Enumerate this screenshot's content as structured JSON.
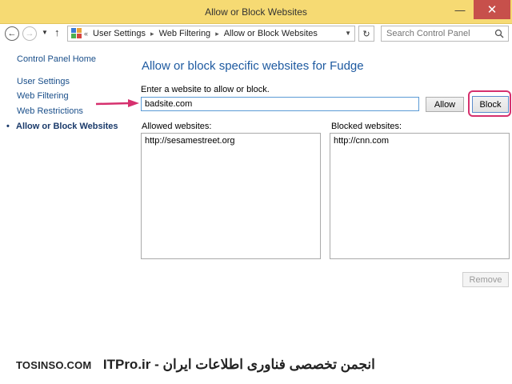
{
  "window": {
    "title": "Allow or Block Websites",
    "minimize_glyph": "—",
    "close_glyph": "✕",
    "close_color": "#c7504b",
    "titlebar_color": "#f6da73"
  },
  "nav": {
    "back_icon": "back-arrow-icon",
    "forward_icon": "forward-arrow-icon",
    "up_icon": "up-arrow-icon",
    "breadcrumb_prefix": "«",
    "breadcrumbs": [
      "User Settings",
      "Web Filtering",
      "Allow or Block Websites"
    ],
    "search_placeholder": "Search Control Panel"
  },
  "sidebar": {
    "home": "Control Panel Home",
    "links": [
      "User Settings",
      "Web Filtering",
      "Web Restrictions"
    ],
    "current": "Allow or Block Websites"
  },
  "main": {
    "heading": "Allow or block specific websites for Fudge",
    "prompt": "Enter a website to allow or block.",
    "input_value": "badsite.com",
    "allow_label": "Allow",
    "block_label": "Block",
    "allowed_label": "Allowed websites:",
    "blocked_label": "Blocked websites:",
    "allowed_sites": [
      "http://sesamestreet.org"
    ],
    "blocked_sites": [
      "http://cnn.com"
    ],
    "remove_label": "Remove"
  },
  "annotation": {
    "highlight_color": "#d6306e"
  },
  "watermark": {
    "site": "TOSINSO.COM",
    "text": "ITPro.ir - انجمن تخصصی فناوری اطلاعات ایران"
  }
}
